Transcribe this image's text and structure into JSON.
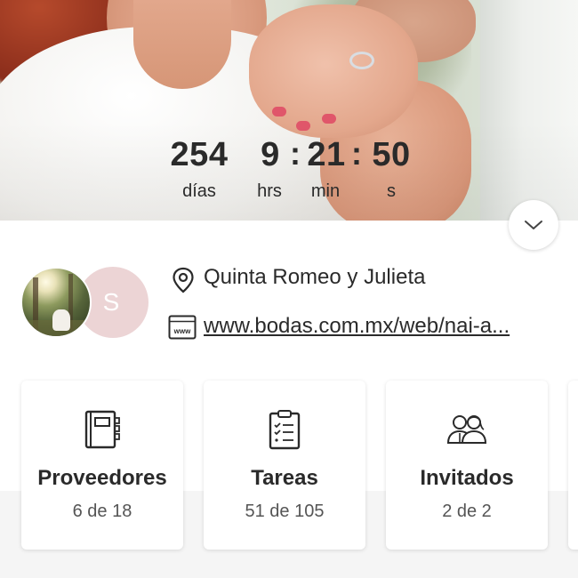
{
  "countdown": {
    "days": "254",
    "hours": "9",
    "minutes": "21",
    "seconds": "50",
    "separator": ":",
    "labels": {
      "days": "días",
      "hours": "hrs",
      "minutes": "min",
      "seconds": "s"
    }
  },
  "profile": {
    "avatar_initial": "S",
    "avatar_color": "#ecd4d5"
  },
  "venue": {
    "icon": "location-pin-icon",
    "name": "Quinta Romeo y Julieta"
  },
  "website": {
    "icon": "web-browser-icon",
    "icon_text": "www",
    "url": "www.bodas.com.mx/web/nai-a..."
  },
  "cards": [
    {
      "icon": "notebook-icon",
      "title": "Proveedores",
      "count": "6 de 18"
    },
    {
      "icon": "clipboard-checklist-icon",
      "title": "Tareas",
      "count": "51 de 105"
    },
    {
      "icon": "guests-couple-icon",
      "title": "Invitados",
      "count": "2 de 2"
    }
  ],
  "colors": {
    "text": "#2a2a2a",
    "nail_accent": "#e0566a"
  }
}
